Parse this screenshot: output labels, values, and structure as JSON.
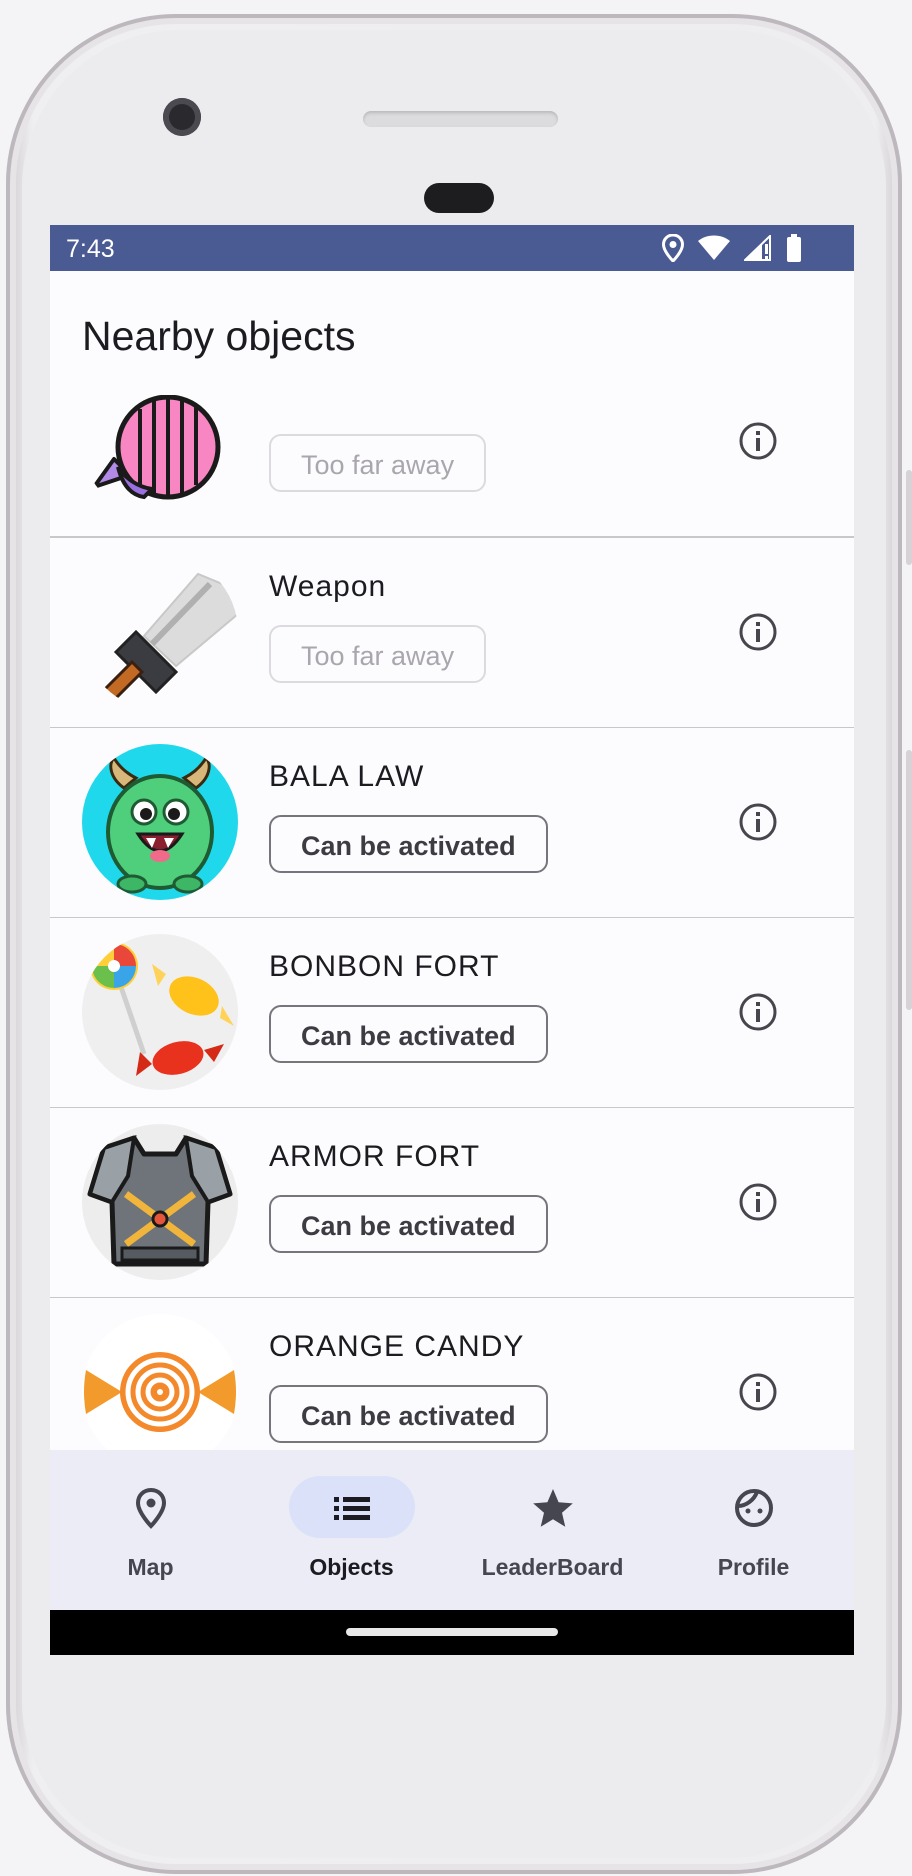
{
  "status_bar": {
    "time": "7:43"
  },
  "header": {
    "title": "Nearby objects"
  },
  "objects": [
    {
      "name": "",
      "status": "Too far away",
      "status_type": "far",
      "image": "striped-candy"
    },
    {
      "name": "Weapon",
      "status": "Too far away",
      "status_type": "far",
      "image": "sword"
    },
    {
      "name": "BALA LAW",
      "status": "Can be activated",
      "status_type": "active",
      "image": "green-monster"
    },
    {
      "name": "BONBON FORT",
      "status": "Can be activated",
      "status_type": "active",
      "image": "candies"
    },
    {
      "name": "ARMOR FORT",
      "status": "Can be activated",
      "status_type": "active",
      "image": "armor"
    },
    {
      "name": "ORANGE CANDY",
      "status": "Can be activated",
      "status_type": "active",
      "image": "orange-candy"
    }
  ],
  "bottom_nav": {
    "selected": "Objects",
    "items": [
      {
        "label": "Map",
        "icon": "map-pin-icon"
      },
      {
        "label": "Objects",
        "icon": "list-icon"
      },
      {
        "label": "LeaderBoard",
        "icon": "star-icon"
      },
      {
        "label": "Profile",
        "icon": "face-icon"
      }
    ]
  },
  "colors": {
    "status_bar": "#4a5b93",
    "nav_bg": "#ececf6",
    "nav_selected": "#dbe1f8"
  }
}
